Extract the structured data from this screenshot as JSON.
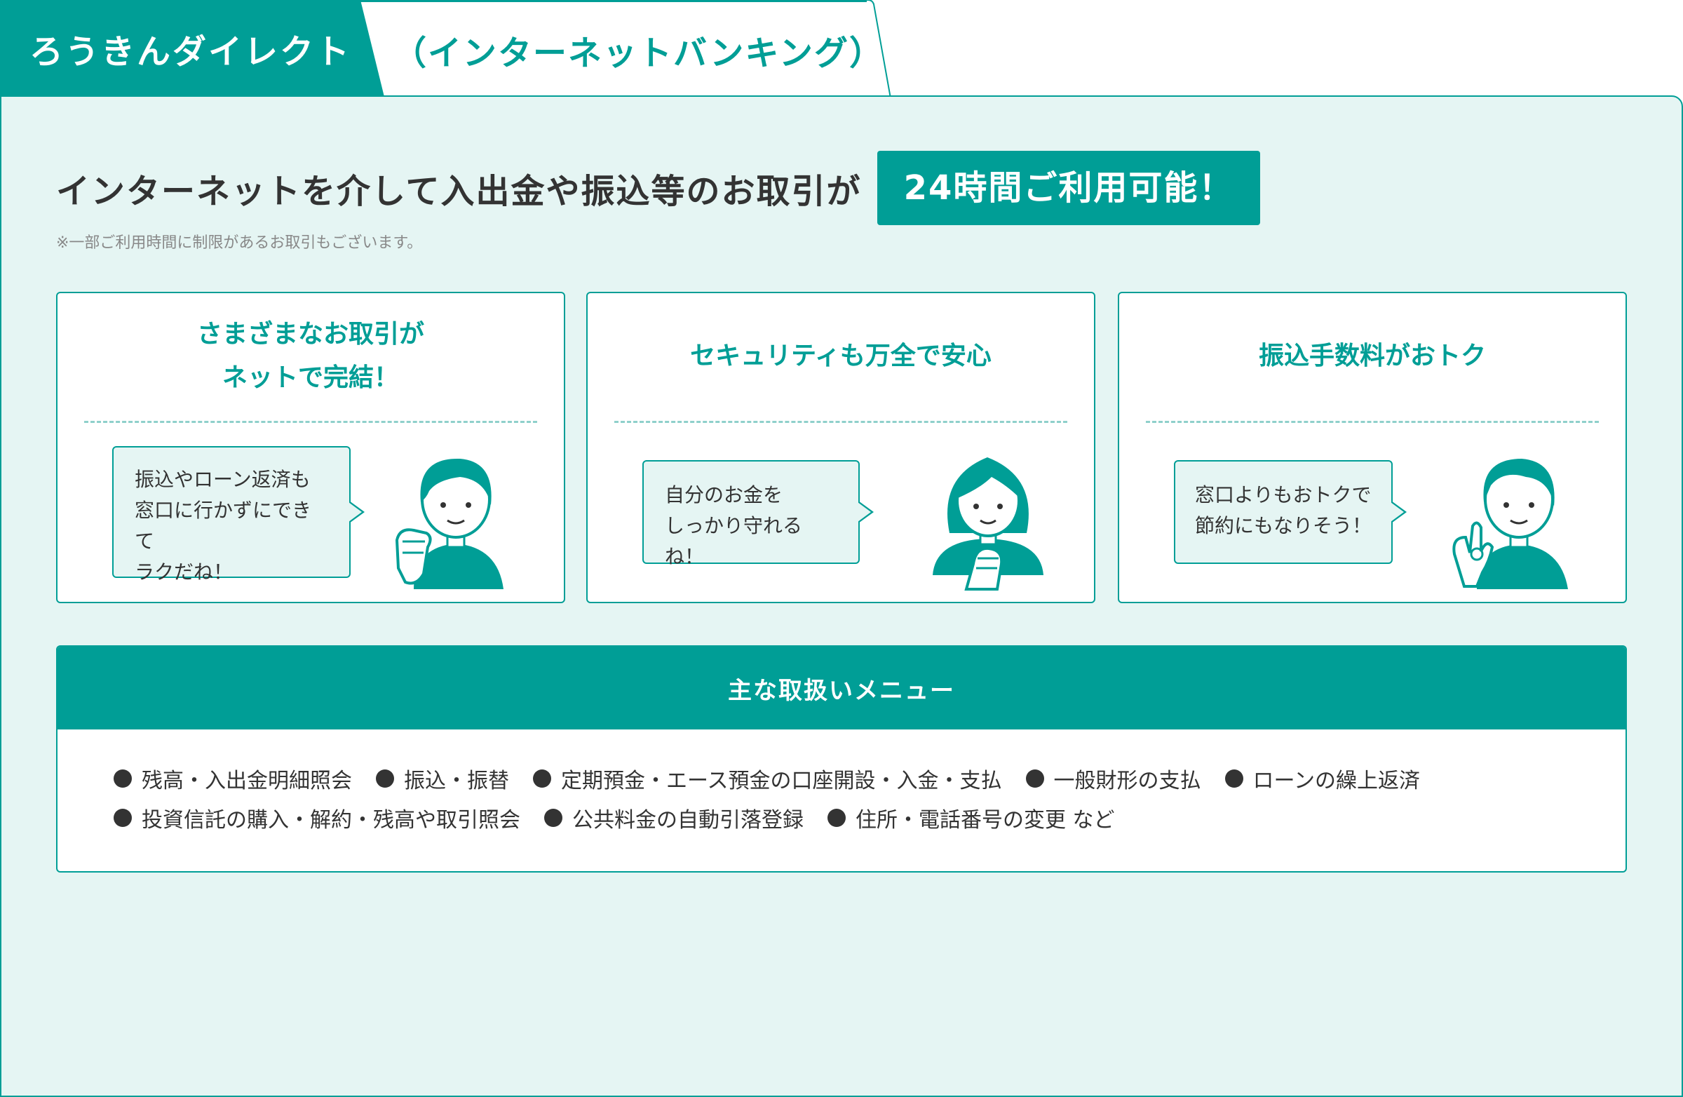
{
  "tabs": {
    "active_label": "ろうきんダイレクト",
    "inactive_label": "（インターネットバンキング）"
  },
  "headline": {
    "text": "インターネットを介して入出金や振込等のお取引が",
    "badge": "24時間ご利用可能！",
    "note": "※一部ご利用時間に制限があるお取引もございます。"
  },
  "features": [
    {
      "title": "さまざまなお取引が\nネットで完結！",
      "bubble": "振込やローン返済も\n窓口に行かずにできて\nラクだね！",
      "figure_icon": "man-fist-icon"
    },
    {
      "title": "セキュリティも万全で安心",
      "bubble": "自分のお金を\nしっかり守れるね！",
      "figure_icon": "woman-clasped-hands-icon"
    },
    {
      "title": "振込手数料がおトク",
      "bubble": "窓口よりもおトクで\n節約にもなりそう！",
      "figure_icon": "man-ok-sign-icon"
    }
  ],
  "menu": {
    "title": "主な取扱いメニュー",
    "rows": [
      [
        "残高・入出金明細照会",
        "振込・振替",
        "定期預金・エース預金の口座開設・入金・支払",
        "一般財形の支払",
        "ローンの繰上返済"
      ],
      [
        "投資信託の購入・解約・残高や取引照会",
        "公共料金の自動引落登録",
        "住所・電話番号の変更 など"
      ]
    ]
  },
  "colors": {
    "brand": "#009e96",
    "panel_bg": "#e5f5f3",
    "text": "#333333"
  }
}
